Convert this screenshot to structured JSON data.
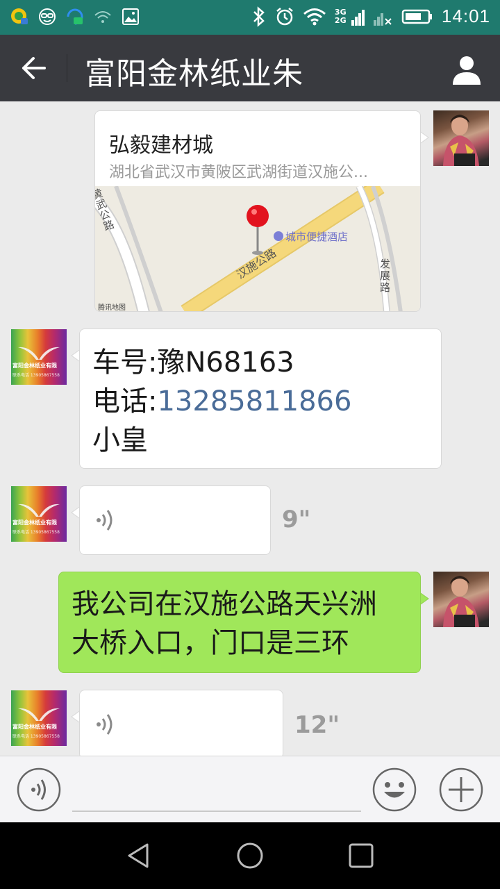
{
  "status_bar": {
    "time": "14:01",
    "network_3g": "3G",
    "network_2g": "2G",
    "icons": [
      "app-notification-icon",
      "glasses-icon",
      "message-icon",
      "wifi-question-icon",
      "image-icon",
      "bluetooth-icon",
      "alarm-icon",
      "wifi-icon",
      "signal-icon",
      "battery-icon"
    ]
  },
  "title_bar": {
    "title": "富阳金林纸业朱",
    "back_icon": "back-arrow-icon",
    "profile_icon": "person-icon"
  },
  "chat": {
    "location_message": {
      "name": "弘毅建材城",
      "address": "湖北省武汉市黄陂区武湖街道汉施公...",
      "map": {
        "poi_label": "城市便捷酒店",
        "road_main": "汉施公路",
        "road_left": "黄武公路",
        "road_right": "发展路",
        "provider": "腾讯地图"
      }
    },
    "text_message_1": {
      "line1": "车号:豫N68163",
      "line2_label": "电话:",
      "line2_phone": "13285811866",
      "line3": "小皇"
    },
    "voice_message_1": {
      "duration": "9\""
    },
    "text_message_2": {
      "line1": "我公司在汉施公路天兴洲",
      "line2": "大桥入口，门口是三环"
    },
    "voice_message_2": {
      "duration": "12\""
    },
    "company_avatar_text": "富阳金林纸业有限",
    "company_avatar_sub": "联系电话 13905867558"
  },
  "input_bar": {
    "voice_icon": "voice-input-icon",
    "emoji_icon": "emoji-icon",
    "plus_icon": "plus-icon"
  },
  "nav_bar": {
    "icons": [
      "back-triangle-icon",
      "home-circle-icon",
      "recents-square-icon"
    ]
  },
  "colors": {
    "status_bar": "#1f7a6e",
    "title_bar": "#393a3f",
    "chat_bg": "#ebebeb",
    "sent_bubble": "#a0e75a",
    "phone_link": "#4a6c98"
  }
}
